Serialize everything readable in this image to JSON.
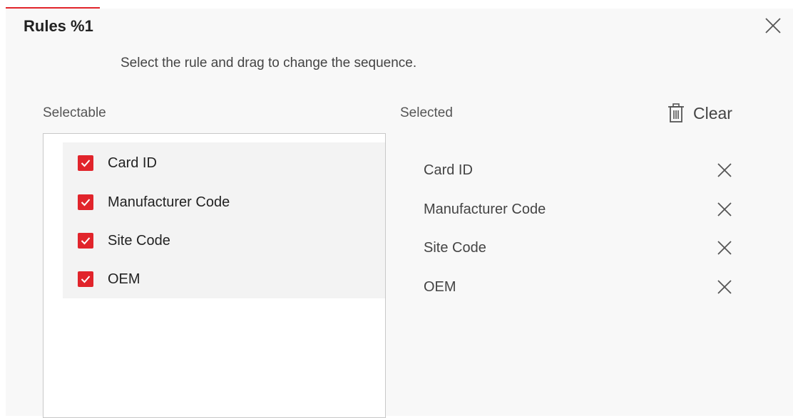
{
  "colors": {
    "accent": "#e1242b",
    "checkbox": "#e1242b",
    "panel_background": "#f8f8f8",
    "list_background": "#f3f3f3"
  },
  "dialog": {
    "title": "Rules %1",
    "hint": "Select the rule and drag to change the sequence.",
    "close_icon": "close-icon"
  },
  "selectable": {
    "label": "Selectable",
    "items": [
      {
        "label": "Card ID",
        "checked": true
      },
      {
        "label": "Manufacturer Code",
        "checked": true
      },
      {
        "label": "Site Code",
        "checked": true
      },
      {
        "label": "OEM",
        "checked": true
      }
    ]
  },
  "selected": {
    "label": "Selected",
    "clear_label": "Clear",
    "clear_icon": "trash-icon",
    "items": [
      {
        "label": "Card ID"
      },
      {
        "label": "Manufacturer Code"
      },
      {
        "label": "Site Code"
      },
      {
        "label": "OEM"
      }
    ]
  }
}
